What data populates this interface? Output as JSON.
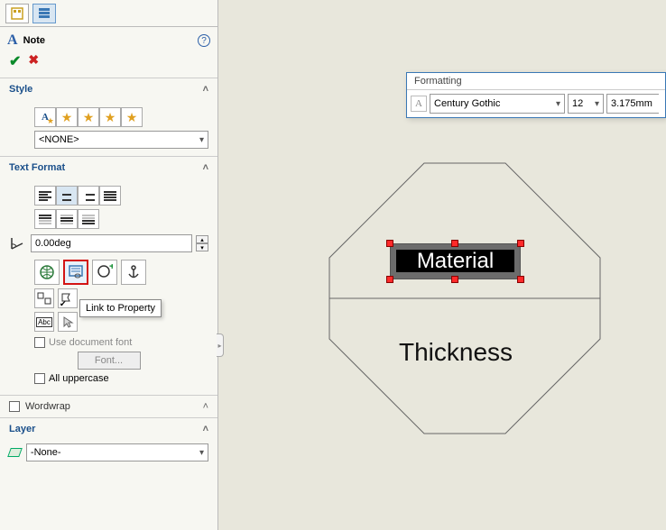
{
  "panel": {
    "title": "Note",
    "style": {
      "header": "Style",
      "preset": "<NONE>"
    },
    "text_format": {
      "header": "Text Format",
      "angle": "0.00deg",
      "tooltip": "Link to Property",
      "use_doc_font": "Use document font",
      "font_button": "Font...",
      "all_uppercase": "All uppercase"
    },
    "wordwrap": {
      "header": "Wordwrap"
    },
    "layer": {
      "header": "Layer",
      "value": "-None-"
    }
  },
  "formatting_bar": {
    "title": "Formatting",
    "font": "Century Gothic",
    "size": "12",
    "extra": "3.175mm"
  },
  "canvas": {
    "material_text": "Material",
    "thickness_text": "Thickness"
  }
}
